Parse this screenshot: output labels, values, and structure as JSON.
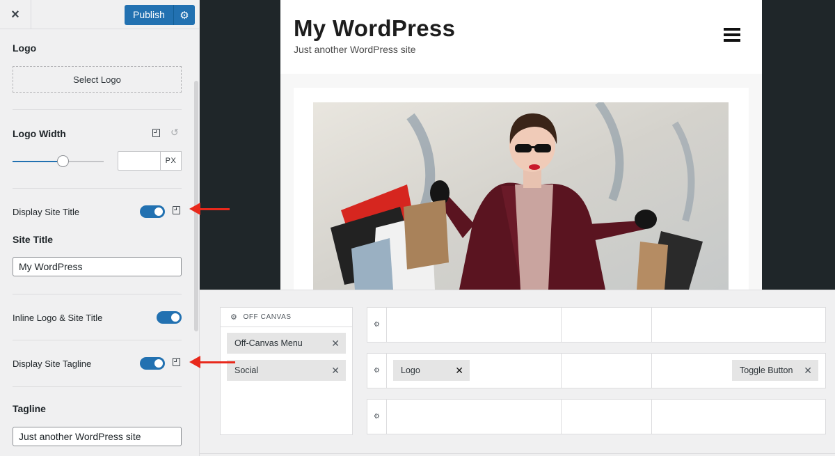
{
  "panel": {
    "close_icon": "×",
    "publish_label": "Publish",
    "gear_icon": "⚙",
    "logo": {
      "label": "Logo",
      "select_label": "Select Logo"
    },
    "logo_width": {
      "label": "Logo Width",
      "value": "",
      "unit": "PX",
      "slider_value": 0.55
    },
    "display_site_title": {
      "label": "Display Site Title",
      "enabled": true
    },
    "site_title": {
      "label": "Site Title",
      "value": "My WordPress"
    },
    "inline_logo": {
      "label": "Inline Logo & Site Title",
      "enabled": true
    },
    "display_tagline": {
      "label": "Display Site Tagline",
      "enabled": true
    },
    "tagline": {
      "label": "Tagline",
      "value": "Just another WordPress site"
    }
  },
  "preview": {
    "site_title": "My WordPress",
    "tagline": "Just another WordPress site"
  },
  "builder": {
    "offcanvas_title": "OFF CANVAS",
    "offcanvas_items": [
      {
        "label": "Off-Canvas Menu",
        "remove": "✕"
      },
      {
        "label": "Social",
        "remove": "✕"
      }
    ],
    "row_items": [
      {
        "label": "Logo",
        "remove": "✕"
      },
      {
        "label": "Toggle Button",
        "remove": "✕"
      }
    ]
  },
  "colors": {
    "accent": "#2271b1",
    "annotation_arrow": "#e8291c",
    "preview_dark": "#1f2629"
  }
}
